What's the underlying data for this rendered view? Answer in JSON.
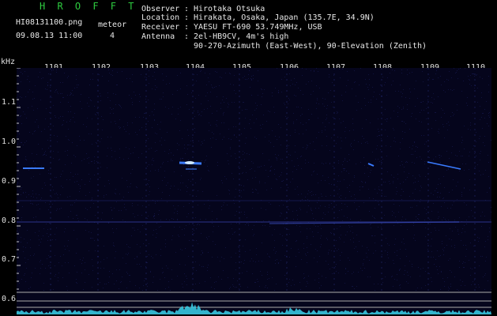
{
  "header": {
    "title": "H R O F F T",
    "filename": "HI08131100.png",
    "datetime": "09.08.13 11:00",
    "meteor_label": "meteor",
    "meteor_count": "4",
    "observer_key": "Observer",
    "observer_value": "Hirotaka Otsuka",
    "location_key": "Location",
    "location_value": "Hirakata, Osaka, Japan (135.7E, 34.9N)",
    "receiver_key": "Receiver",
    "receiver_value": "YAESU FT-690 53.749MHz, USB",
    "antenna_key": "Antenna",
    "antenna_value": "2el-HB9CV, 4m's high",
    "antenna_value2": "90-270-Azimuth (East-West), 90-Elevation (Zenith)",
    "separator": ":"
  },
  "axes": {
    "y_unit": "kHz",
    "y_ticks": [
      "1.1",
      "1.0",
      "0.9",
      "0.8",
      "0.7",
      "0.6"
    ],
    "x_ticks": [
      "1101",
      "1102",
      "1103",
      "1104",
      "1105",
      "1106",
      "1107",
      "1108",
      "1109",
      "1110"
    ]
  },
  "colors": {
    "background": "#000000",
    "plot_bg": "#05051c",
    "title": "#2ecc40",
    "echo": "#3a7bff",
    "echo_core": "#cfe8ff",
    "baseline": "#aaaaaa",
    "noise_trace": "#39c8e0"
  }
}
